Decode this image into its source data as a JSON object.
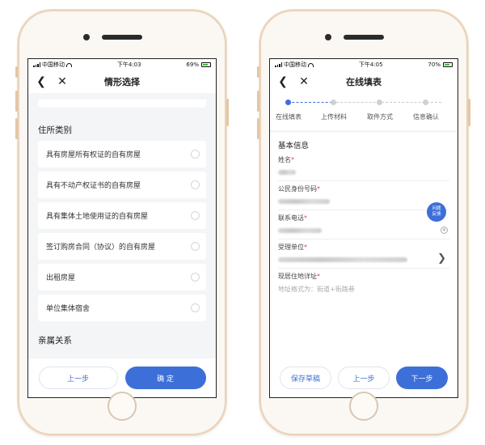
{
  "left_screen": {
    "status": {
      "carrier": "中国移动",
      "time": "下午4:03",
      "battery": "69%"
    },
    "nav": {
      "title": "情形选择"
    },
    "section_title": "住所类别",
    "options": [
      "具有房屋所有权证的自有房屋",
      "具有不动产权证书的自有房屋",
      "具有集体土地使用证的自有房屋",
      "签订购房合同（协议）的自有房屋",
      "出租房屋",
      "单位集体宿舍"
    ],
    "next_section_title": "亲属关系",
    "buttons": {
      "prev": "上一步",
      "confirm": "确 定"
    }
  },
  "right_screen": {
    "status": {
      "carrier": "中国移动",
      "time": "下午4:05",
      "battery": "70%"
    },
    "nav": {
      "title": "在线填表"
    },
    "steps": [
      "在线填表",
      "上传材料",
      "取件方式",
      "信息确认"
    ],
    "form": {
      "heading": "基本信息",
      "fields": {
        "name": "姓名",
        "id_number": "公民身份号码",
        "phone": "联系电话",
        "agency": "受理单位",
        "address": "现居住地详址"
      },
      "address_placeholder": "地址格式为：街道+街路巷",
      "required_mark": "*"
    },
    "help_badge": {
      "line1": "问题",
      "line2": "反馈"
    },
    "buttons": {
      "save": "保存草稿",
      "prev": "上一步",
      "next": "下一步"
    }
  },
  "colors": {
    "accent": "#3d6fd8",
    "phone_frame": "#e9d2b8",
    "background": "#f4f5f7"
  },
  "icons": [
    "back-chevron-icon",
    "close-icon",
    "wifi-icon",
    "battery-icon",
    "chevron-right-icon",
    "clear-icon"
  ]
}
